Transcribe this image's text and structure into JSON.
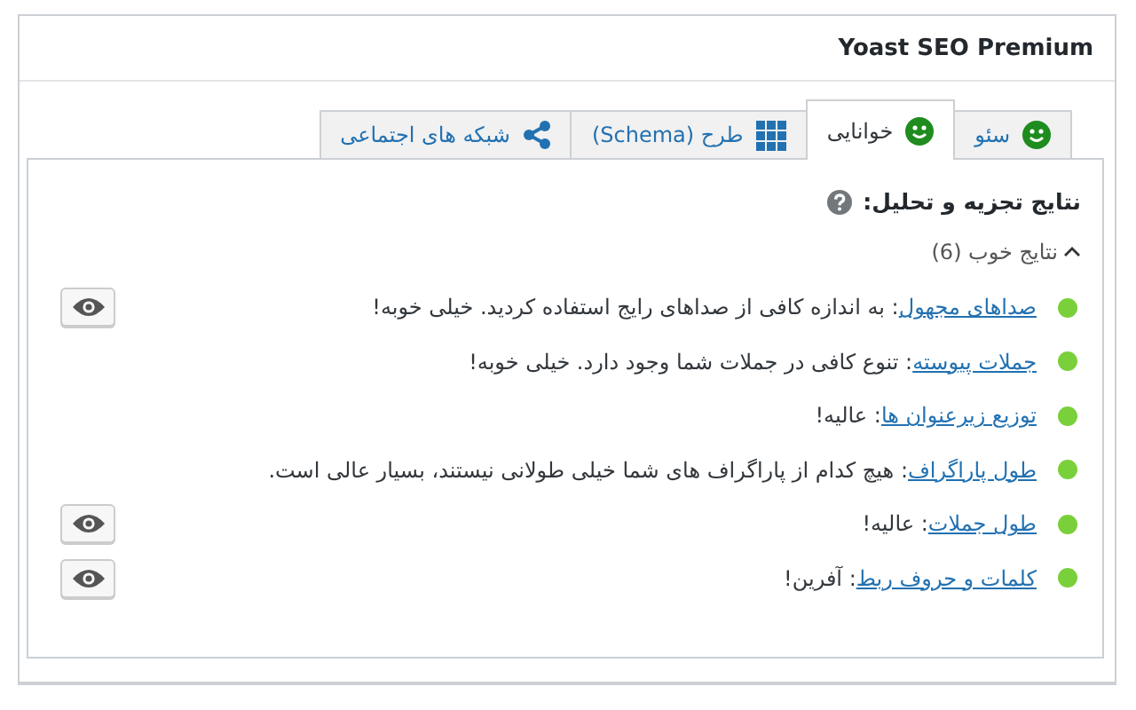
{
  "panel": {
    "title": "Yoast SEO Premium"
  },
  "tabs": [
    {
      "label": "سئو",
      "kind": "score",
      "selected": false
    },
    {
      "label": "خوانایی",
      "kind": "score",
      "selected": true
    },
    {
      "label": "طرح (Schema)",
      "kind": "schema",
      "selected": false
    },
    {
      "label": "شبکه های اجتماعی",
      "kind": "social",
      "selected": false
    }
  ],
  "analysis": {
    "heading": "نتایج تجزیه و تحلیل:",
    "group": {
      "label": "نتایج خوب (6)",
      "expanded": true
    },
    "results": [
      {
        "link": "صداهای مجهول",
        "text": ": به اندازه کافی از صداهای رایج استفاده کردید. خیلی خوبه!",
        "color": "#7ad03a",
        "highlight_button": true
      },
      {
        "link": "جملات پیوسته",
        "text": ": تنوع کافی در جملات شما وجود دارد. خیلی خوبه!",
        "color": "#7ad03a",
        "highlight_button": false
      },
      {
        "link": "توزیع زیرعنوان ها",
        "text": ": عالیه!",
        "color": "#7ad03a",
        "highlight_button": false
      },
      {
        "link": "طول پاراگراف",
        "text": ": هیچ کدام از پاراگراف های شما خیلی طولانی نیستند، بسیار عالی است.",
        "color": "#7ad03a",
        "highlight_button": false
      },
      {
        "link": "طول جملات",
        "text": ": عالیه!",
        "color": "#7ad03a",
        "highlight_button": true
      },
      {
        "link": "کلمات و حروف ربط",
        "text": ": آفرین!",
        "color": "#7ad03a",
        "highlight_button": true
      }
    ]
  }
}
